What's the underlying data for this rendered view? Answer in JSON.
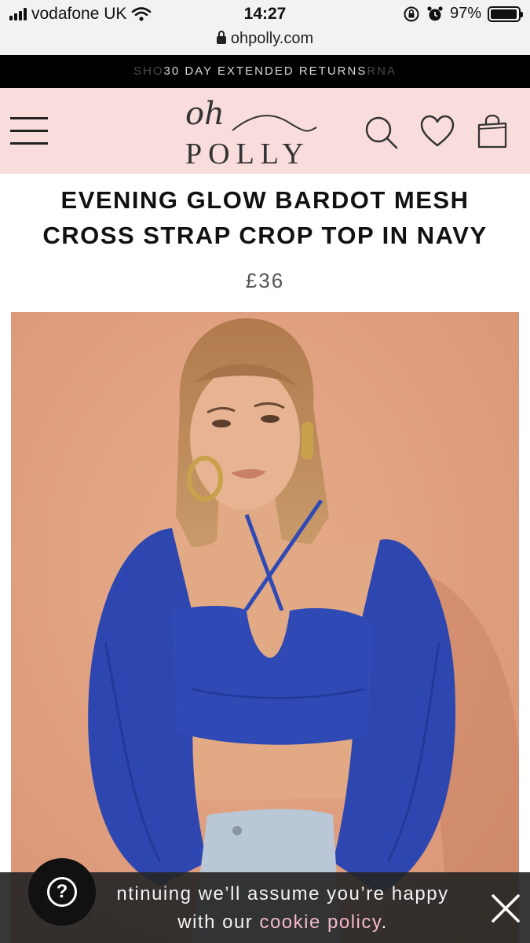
{
  "status_bar": {
    "carrier": "vodafone UK",
    "time": "14:27",
    "battery": "97%",
    "battery_level": 0.97
  },
  "browser": {
    "url": "ohpolly.com"
  },
  "promo": {
    "left_fragment": "SHO",
    "text": "30 DAY EXTENDED RETURNS",
    "right_fragment": "RNA"
  },
  "logo": {
    "top": "oh",
    "bottom": "POLLY"
  },
  "header_icons": [
    "menu-icon",
    "search-icon",
    "heart-icon",
    "shopping-bag-icon"
  ],
  "product": {
    "title_line1": "EVENING GLOW BARDOT MESH",
    "title_line2": "CROSS STRAP CROP TOP IN NAVY",
    "price": "£36"
  },
  "cookie": {
    "line1": "ntinuing we’ll assume you’re happy",
    "line2_prefix": "with our ",
    "link": "cookie policy",
    "line2_suffix": "."
  },
  "help_button": {
    "label": "?"
  },
  "colors": {
    "header_bg": "#f9dcdc",
    "promo_bg": "#000000",
    "cookie_link": "#f3b9c8",
    "garment": "#2f49b5",
    "backdrop": "#df9f7e"
  }
}
